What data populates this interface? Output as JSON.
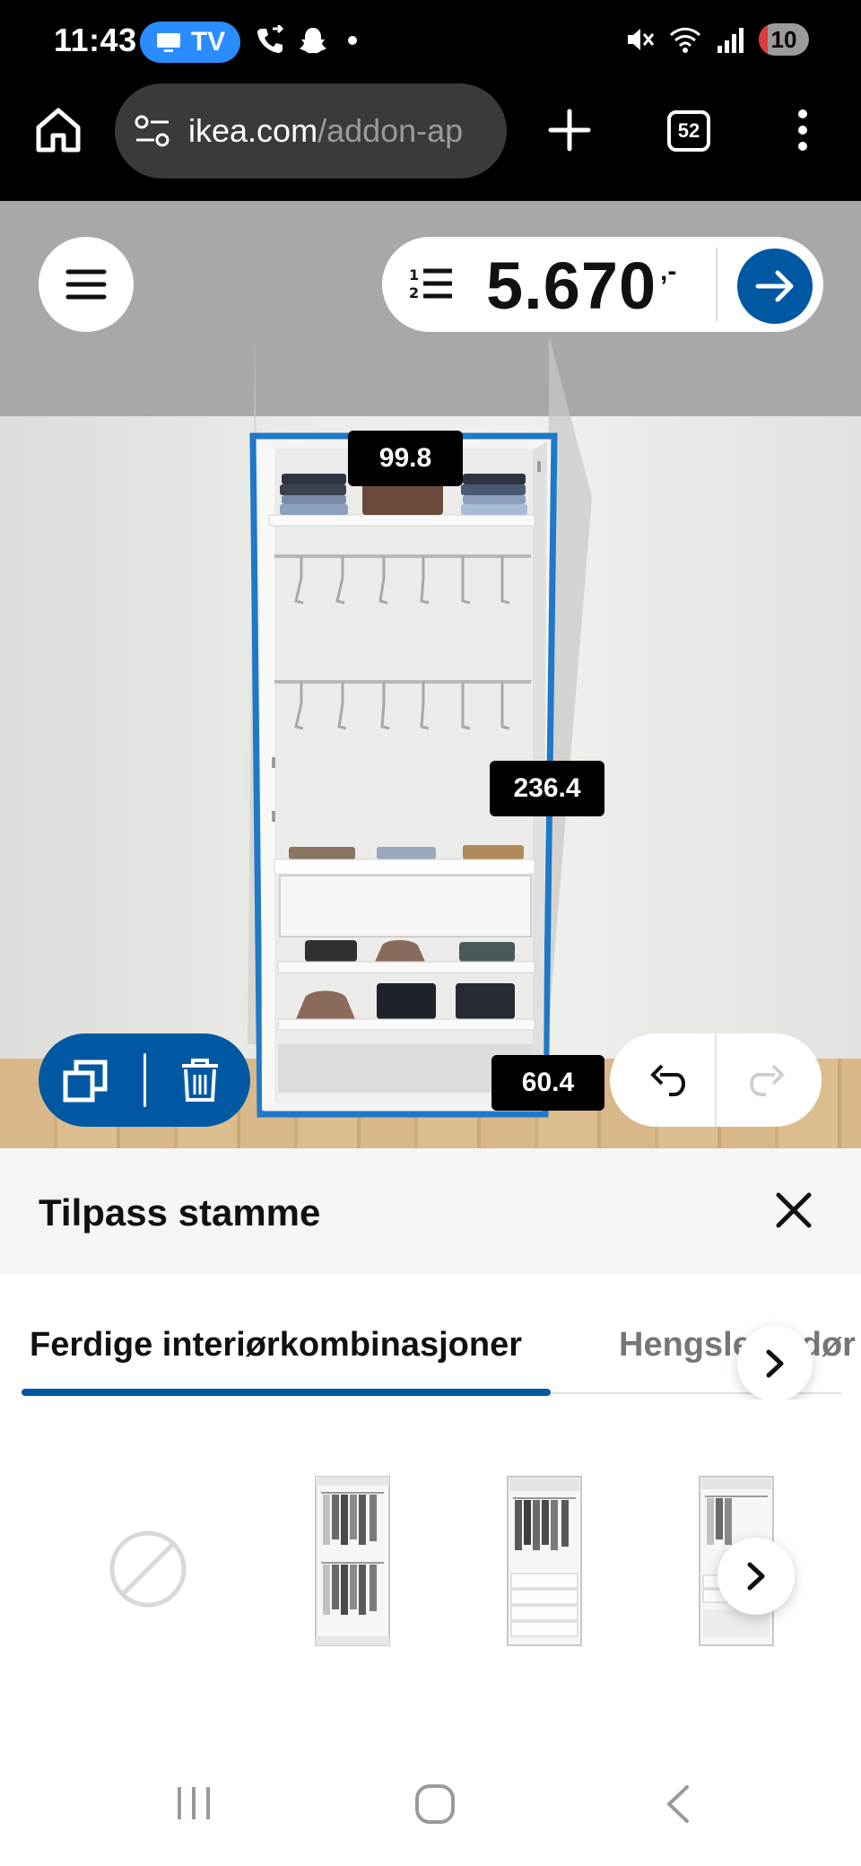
{
  "status_bar": {
    "time": "11:43",
    "tv_badge": "TV",
    "battery_level": "10",
    "battery_fraction": 0.18,
    "icons": [
      "tv-icon",
      "call-forwarding-icon",
      "snapchat-icon",
      "notification-dot",
      "mute-icon",
      "wifi-icon",
      "signal-icon",
      "battery-icon"
    ]
  },
  "browser": {
    "url_host": "ikea.com",
    "url_path": "/addon-ap",
    "tab_count": "52",
    "icons": [
      "home-icon",
      "site-settings-icon",
      "plus-icon",
      "kebab-menu-icon"
    ]
  },
  "planner": {
    "price": "5.670",
    "price_suffix": ",-",
    "dimensions": {
      "top": "99.8",
      "height": "236.4",
      "width": "60.4"
    },
    "colors": {
      "brand_blue": "#0058a3",
      "selection_outline": "#1f78c8"
    },
    "icons": [
      "hamburger-icon",
      "numbered-list-icon",
      "arrow-right-icon",
      "duplicate-icon",
      "trash-icon",
      "undo-icon",
      "redo-icon"
    ]
  },
  "panel": {
    "title": "Tilpass stamme",
    "tabs": [
      "Ferdige interiørkombinasjoner",
      "Hengslede dør"
    ],
    "active_tab": 0,
    "combinations": [
      "no-combination",
      "wardrobe-combo-1",
      "wardrobe-combo-2",
      "wardrobe-combo-3"
    ]
  },
  "nav": {
    "buttons": [
      "recents-button",
      "home-button",
      "back-button"
    ]
  }
}
